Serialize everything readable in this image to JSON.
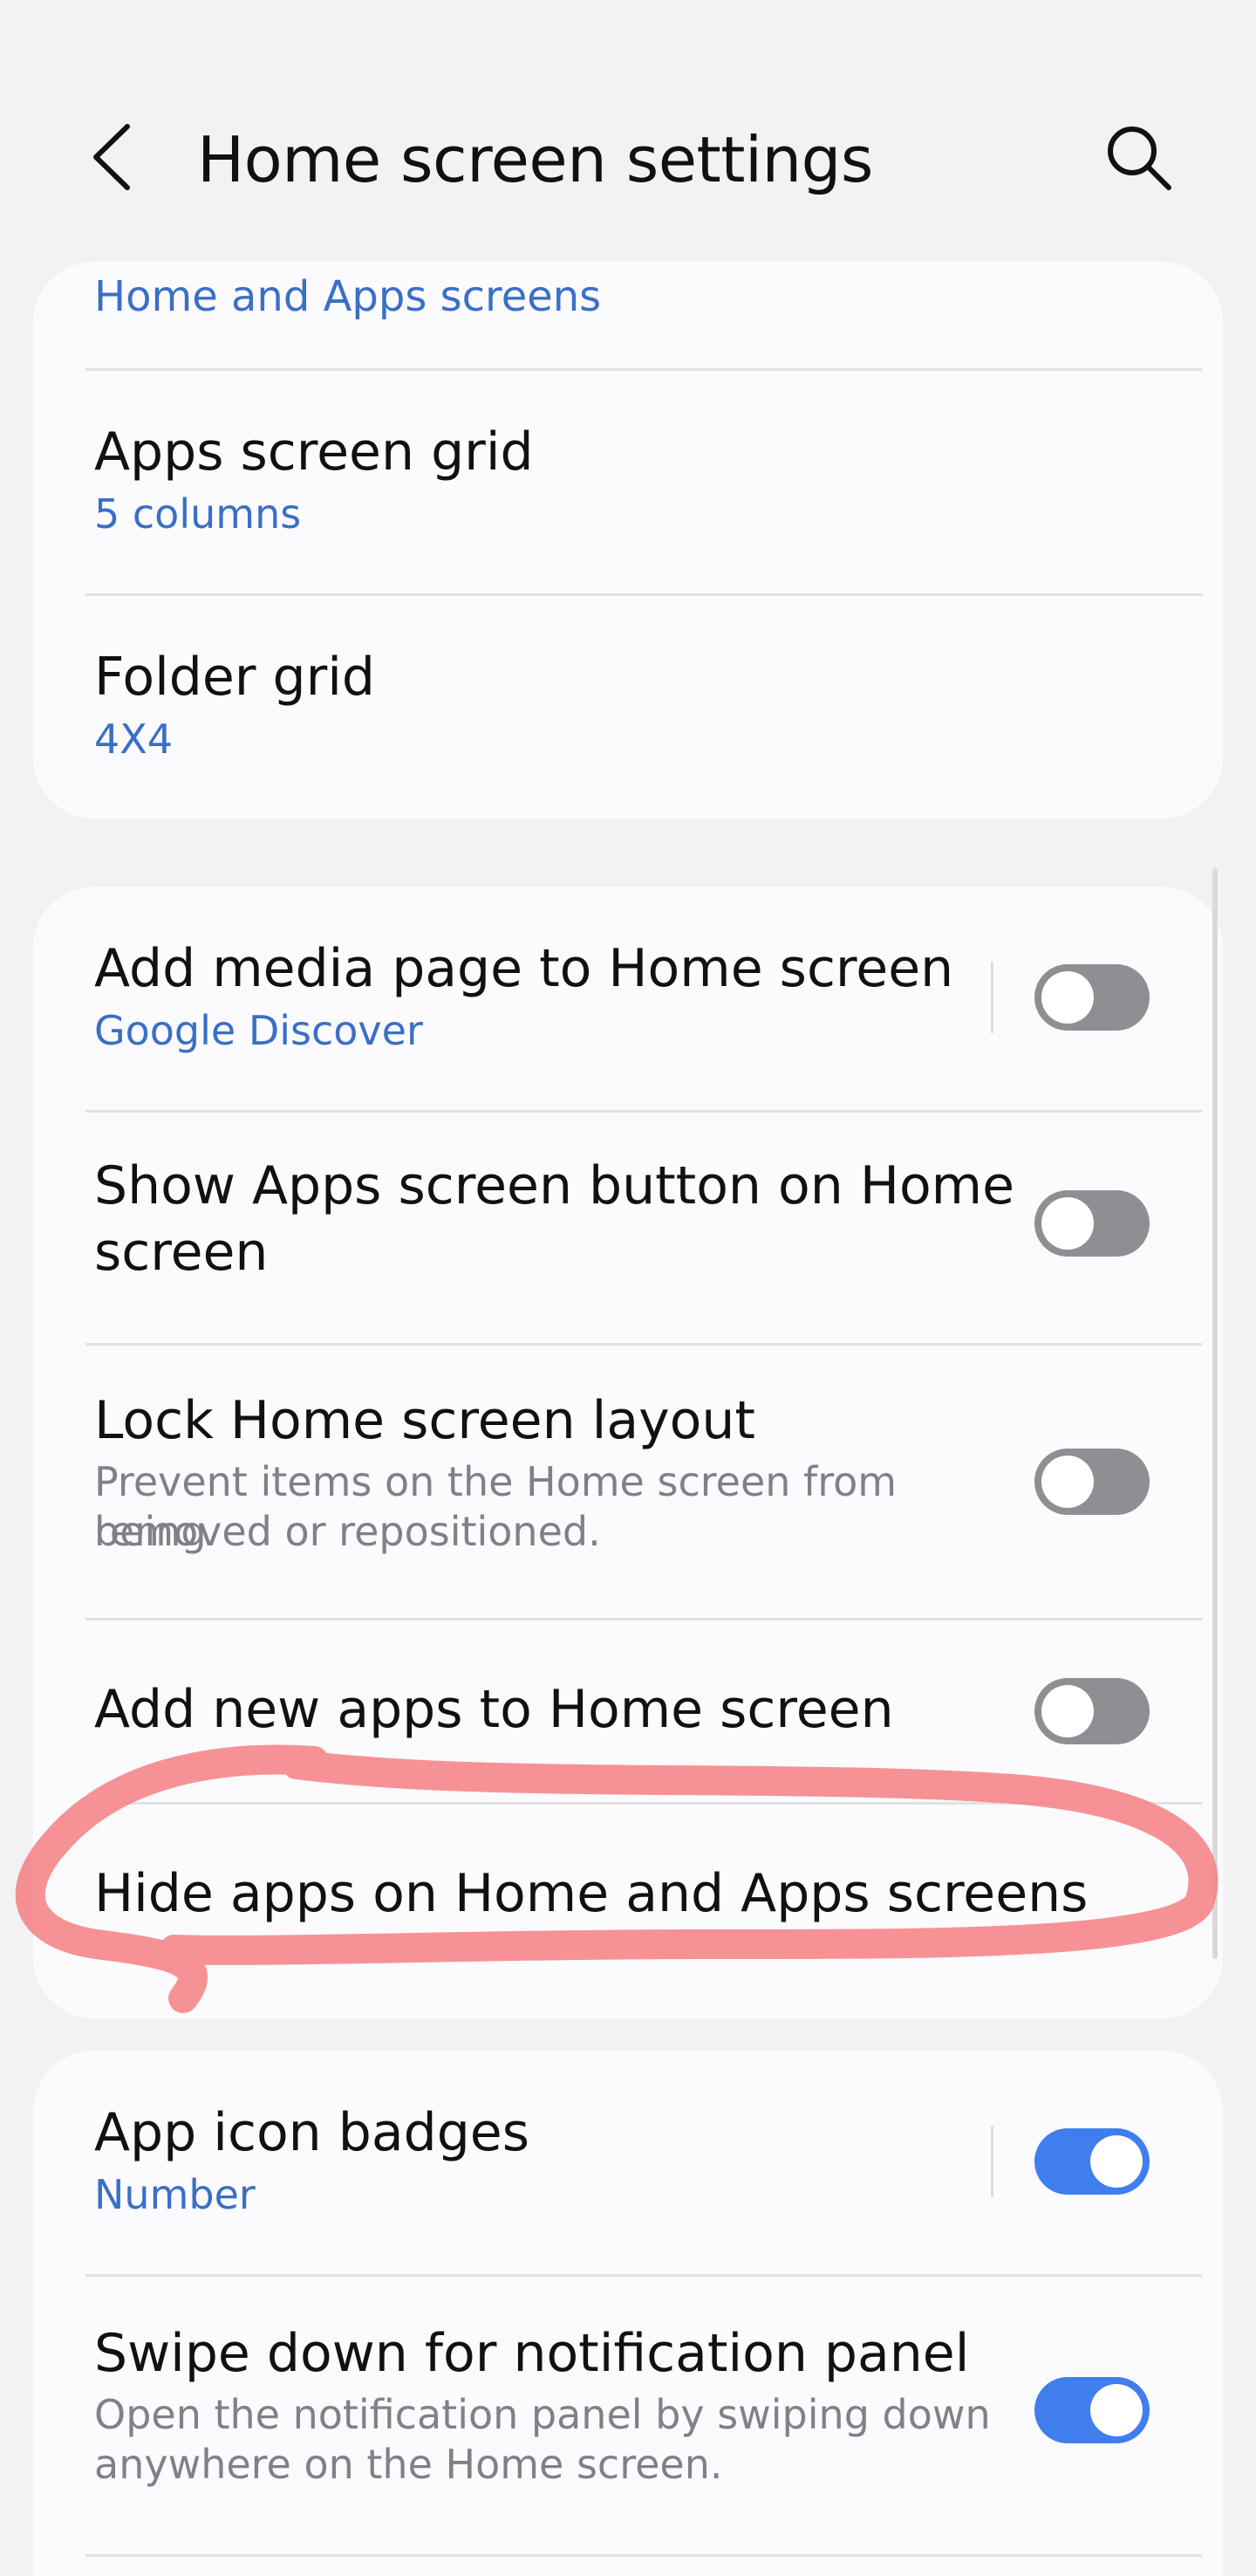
{
  "header": {
    "title": "Home screen settings"
  },
  "card1": {
    "section_link": "Home and Apps screens",
    "items": [
      {
        "title": "Apps screen grid",
        "sub": "5 columns"
      },
      {
        "title": "Folder grid",
        "sub": "4X4"
      }
    ]
  },
  "card2": {
    "items": [
      {
        "title": "Add media page to Home screen",
        "sub": "Google Discover",
        "toggle": "off"
      },
      {
        "title_line1": "Show Apps screen button on Home",
        "title_line2": "screen",
        "toggle": "off"
      },
      {
        "title": "Lock Home screen layout",
        "desc_line1": "Prevent items on the Home screen from being",
        "desc_line2": "removed or repositioned.",
        "toggle": "off"
      },
      {
        "title": "Add new apps to Home screen",
        "toggle": "off"
      },
      {
        "title": "Hide apps on Home and Apps screens"
      }
    ]
  },
  "card3": {
    "items": [
      {
        "title": "App icon badges",
        "sub": "Number",
        "toggle": "on"
      },
      {
        "title": "Swipe down for notification panel",
        "desc_line1": "Open the notification panel by swiping down",
        "desc_line2": "anywhere on the Home screen.",
        "toggle": "on"
      }
    ]
  },
  "colors": {
    "accent": "#3a6fc6",
    "toggle_on": "#3f7eed",
    "toggle_off": "#8e8e93",
    "annotation": "#f47f82"
  }
}
